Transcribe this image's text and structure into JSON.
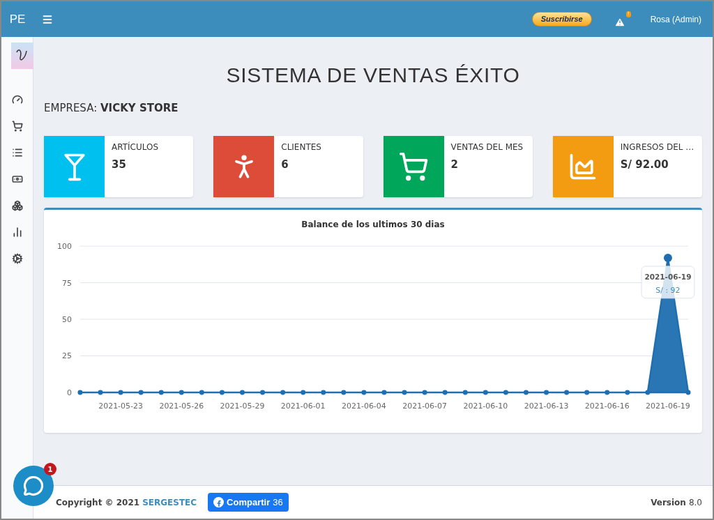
{
  "header": {
    "brand": "PE",
    "subscribe_button": "Suscribirse",
    "alerts_badge": "!",
    "user": "Rosa (Admin)"
  },
  "page_title": "SISTEMA DE VENTAS ÉXITO",
  "company": {
    "label": "EMPRESA:",
    "name": "VICKY STORE"
  },
  "stats": [
    {
      "label": "ARTÍCULOS",
      "value": "35",
      "color": "#00c0ef"
    },
    {
      "label": "CLIENTES",
      "value": "6",
      "color": "#dd4b39"
    },
    {
      "label": "VENTAS DEL MES",
      "value": "2",
      "color": "#00a65a"
    },
    {
      "label": "INGRESOS DEL …",
      "value": "S/ 92.00",
      "color": "#f39c12"
    }
  ],
  "chart": {
    "chart_data": {
      "type": "area",
      "title": "Balance de los ultimos 30 dias",
      "grid": true,
      "categories": [
        null,
        null,
        "2021-05-23",
        null,
        null,
        "2021-05-26",
        null,
        null,
        "2021-05-29",
        null,
        null,
        "2021-06-01",
        null,
        null,
        "2021-06-04",
        null,
        null,
        "2021-06-07",
        null,
        null,
        "2021-06-10",
        null,
        null,
        "2021-06-13",
        null,
        null,
        "2021-06-16",
        null,
        null,
        "2021-06-19",
        null
      ],
      "series": [
        {
          "color": "#1f6fb0",
          "values": [
            0,
            0,
            0,
            0,
            0,
            0,
            0,
            0,
            0,
            0,
            0,
            0,
            0,
            0,
            0,
            0,
            0,
            0,
            0,
            0,
            0,
            0,
            0,
            0,
            0,
            0,
            0,
            0,
            0,
            92,
            0
          ]
        }
      ],
      "ylim": [
        0,
        100
      ],
      "yticks": [
        0,
        25,
        50,
        75,
        100
      ]
    },
    "tooltip": {
      "title": "2021-06-19",
      "value": "S/ : 92"
    }
  },
  "footer": {
    "copyright": "Copyright © 2021",
    "company_link": "SERGESTEC",
    "share_button": "Compartir",
    "share_count": "36",
    "version_label": "Version",
    "version": "8.0"
  },
  "chat_badge": "1"
}
